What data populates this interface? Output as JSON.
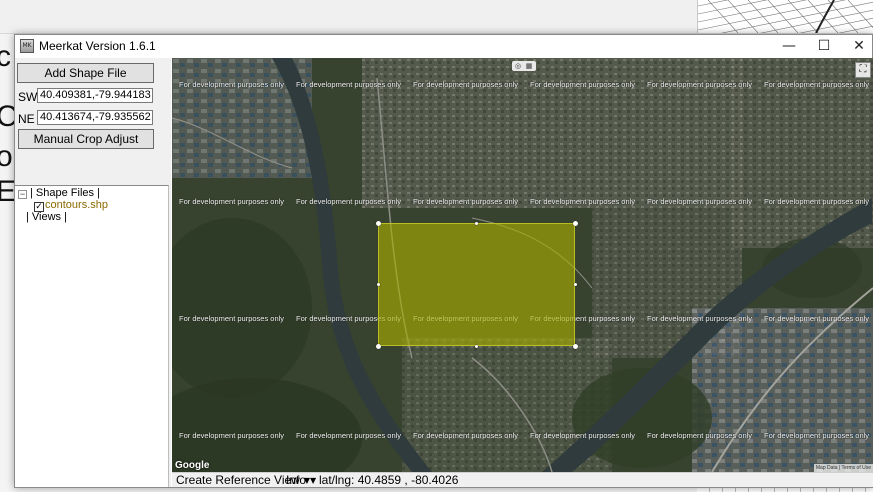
{
  "background": {
    "letters": [
      "c",
      "C",
      "o",
      "E"
    ]
  },
  "window": {
    "title": "Meerkat Version 1.6.1",
    "app_icon_text": "MK",
    "controls": {
      "minimize": "—",
      "maximize": "☐",
      "close": "✕"
    }
  },
  "panel": {
    "add_shape_file_label": "Add Shape File",
    "sw_label": "SW",
    "sw_value": "40.409381,-79.944183",
    "ne_label": "NE",
    "ne_value": "40.413674,-79.935562",
    "manual_crop_label": "Manual Crop Adjust",
    "tree": {
      "expander": "−",
      "shape_files_label": "| Shape Files |",
      "file_check": "✓",
      "file_name": "contours.shp",
      "views_label": "| Views |"
    }
  },
  "map": {
    "watermark_text": "For development purposes only",
    "provider_logo": "Google",
    "attribution": "Map Data  |  Terms of Use",
    "fullscreen_icon": "⛶",
    "layer_icons": [
      "◎",
      "▦"
    ],
    "colors": {
      "crop_overlay": "#aaaf00",
      "river": "#2f3b3c"
    }
  },
  "statusbar": {
    "view_selector": "Create Reference View",
    "info_selector": "Info",
    "latlng_label": "lat/lng:",
    "latlng_value": "40.4859 , -80.4026"
  }
}
